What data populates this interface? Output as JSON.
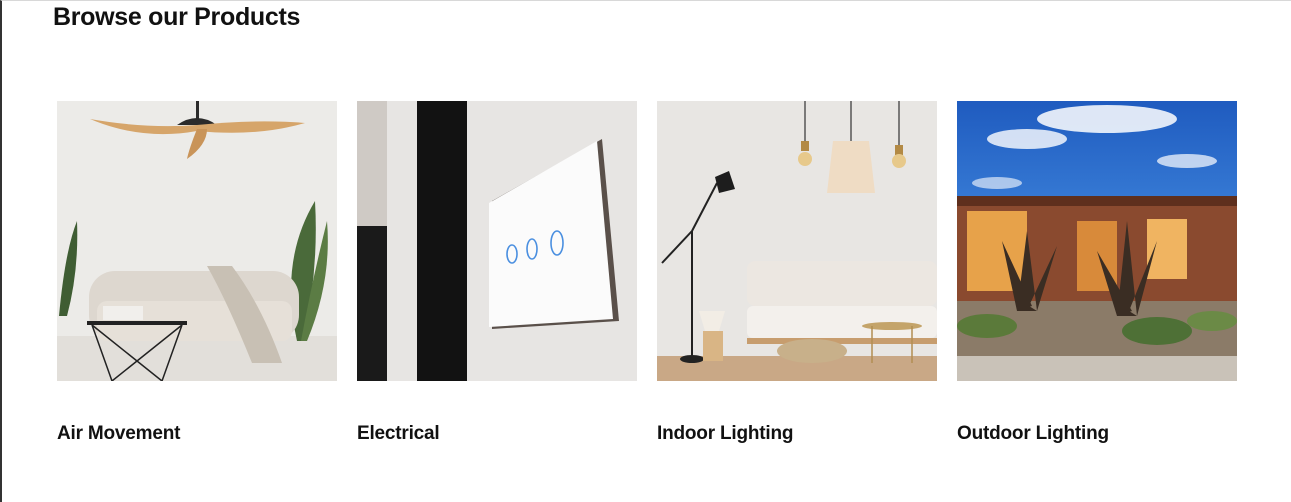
{
  "section": {
    "title": "Browse our Products"
  },
  "products": [
    {
      "label": "Air Movement",
      "image": "ceiling-fan-living-room"
    },
    {
      "label": "Electrical",
      "image": "wall-touch-switch"
    },
    {
      "label": "Indoor Lighting",
      "image": "pendant-and-floor-lamp-room"
    },
    {
      "label": "Outdoor Lighting",
      "image": "house-garden-lights"
    }
  ]
}
